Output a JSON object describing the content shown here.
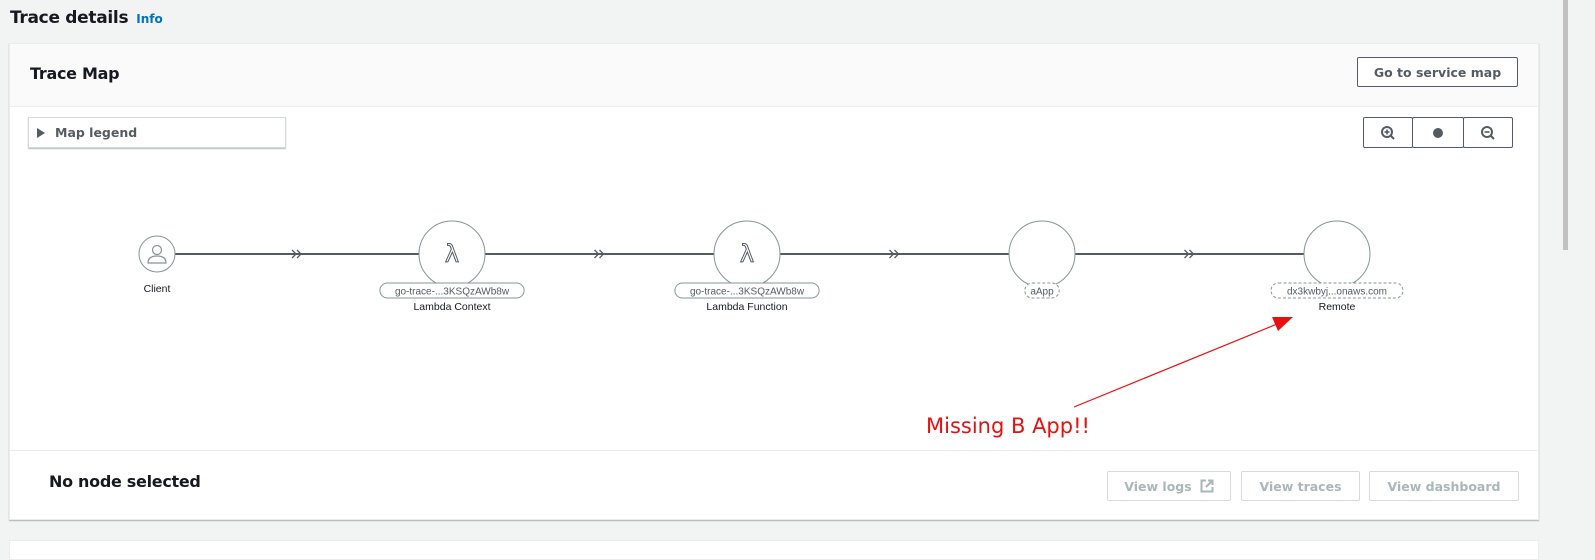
{
  "page": {
    "title": "Trace details",
    "info_link": "Info"
  },
  "panel": {
    "title": "Trace Map",
    "service_map_button": "Go to service map"
  },
  "map": {
    "legend_label": "Map legend",
    "zoom_controls": [
      {
        "name": "zoom-in",
        "icon": "zoom-in-icon"
      },
      {
        "name": "reset",
        "icon": "dot-icon"
      },
      {
        "name": "zoom-out",
        "icon": "zoom-out-icon"
      }
    ],
    "nodes": [
      {
        "id": "client",
        "type": "client",
        "badge": "",
        "badge_style": "none",
        "label": "Client",
        "icon": "user-icon"
      },
      {
        "id": "lambda-context",
        "type": "lambda",
        "badge": "go-trace-...3KSQzAWb8w",
        "badge_style": "solid",
        "label": "Lambda Context",
        "icon": "lambda-icon"
      },
      {
        "id": "lambda-function",
        "type": "lambda",
        "badge": "go-trace-...3KSQzAWb8w",
        "badge_style": "solid",
        "label": "Lambda Function",
        "icon": "lambda-icon"
      },
      {
        "id": "aapp",
        "type": "service",
        "badge": "aApp",
        "badge_style": "dashed",
        "label": "",
        "icon": ""
      },
      {
        "id": "remote",
        "type": "remote",
        "badge": "dx3kwbyj...onaws.com",
        "badge_style": "dashed",
        "label": "Remote",
        "icon": ""
      }
    ],
    "edges": [
      {
        "from": "client",
        "to": "lambda-context"
      },
      {
        "from": "lambda-context",
        "to": "lambda-function"
      },
      {
        "from": "lambda-function",
        "to": "aapp"
      },
      {
        "from": "aapp",
        "to": "remote"
      }
    ],
    "annotation": {
      "text": "Missing B App!!",
      "color": "#e8100f",
      "points_to": "remote"
    }
  },
  "detail": {
    "title": "No node selected",
    "buttons": {
      "view_logs": "View logs",
      "view_traces": "View traces",
      "view_dashboard": "View dashboard"
    }
  },
  "colors": {
    "link": "#0073bb",
    "edge": "#545b64",
    "disabled": "#aab7b8"
  }
}
